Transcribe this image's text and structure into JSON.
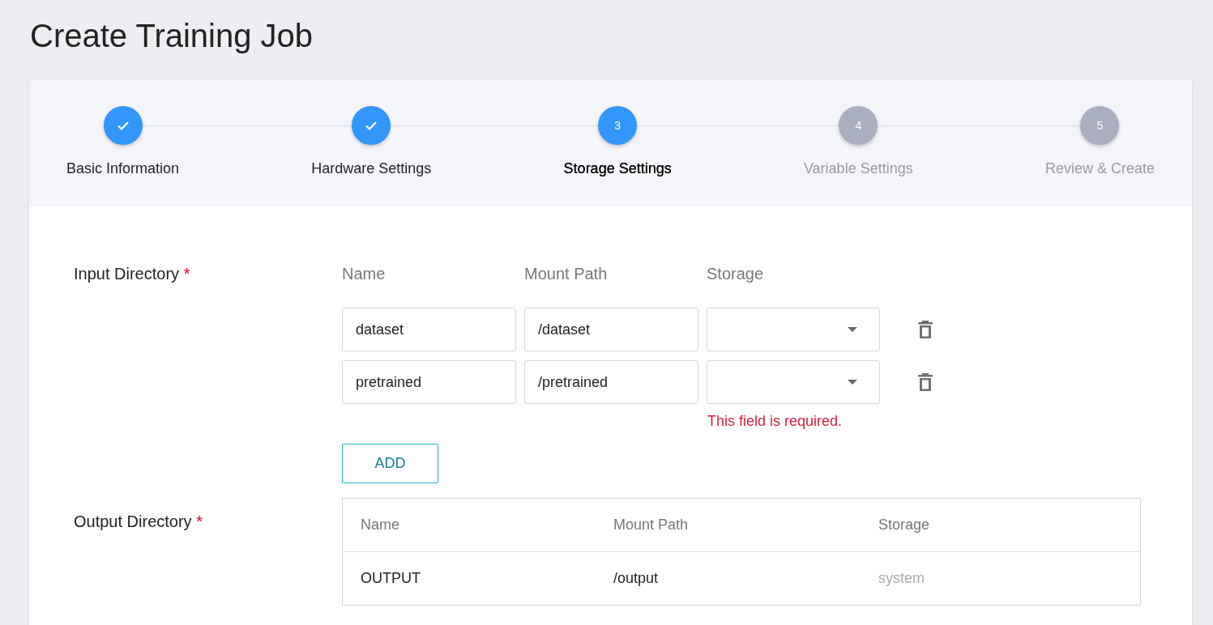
{
  "page_title": "Create Training Job",
  "steps": [
    {
      "label": "Basic Information",
      "completed": true,
      "selected": false
    },
    {
      "label": "Hardware Settings",
      "completed": true,
      "selected": false
    },
    {
      "label": "Storage Settings",
      "completed": false,
      "selected": true,
      "number": "3"
    },
    {
      "label": "Variable Settings",
      "completed": false,
      "selected": false,
      "number": "4"
    },
    {
      "label": "Review & Create",
      "completed": false,
      "selected": false,
      "number": "5"
    }
  ],
  "input_directory": {
    "label": "Input Directory",
    "required_mark": "*",
    "columns": [
      "Name",
      "Mount Path",
      "Storage"
    ],
    "rows": [
      {
        "name": "dataset",
        "mount_path": "/dataset"
      },
      {
        "name": "pretrained",
        "mount_path": "/pretrained",
        "error": "This field is required."
      }
    ],
    "add_button": "ADD"
  },
  "output_directory": {
    "label": "Output Directory",
    "required_mark": "*",
    "columns": [
      "Name",
      "Mount Path",
      "Storage"
    ],
    "rows": [
      {
        "name": "OUTPUT",
        "mount_path": "/output",
        "storage": "system"
      }
    ]
  }
}
